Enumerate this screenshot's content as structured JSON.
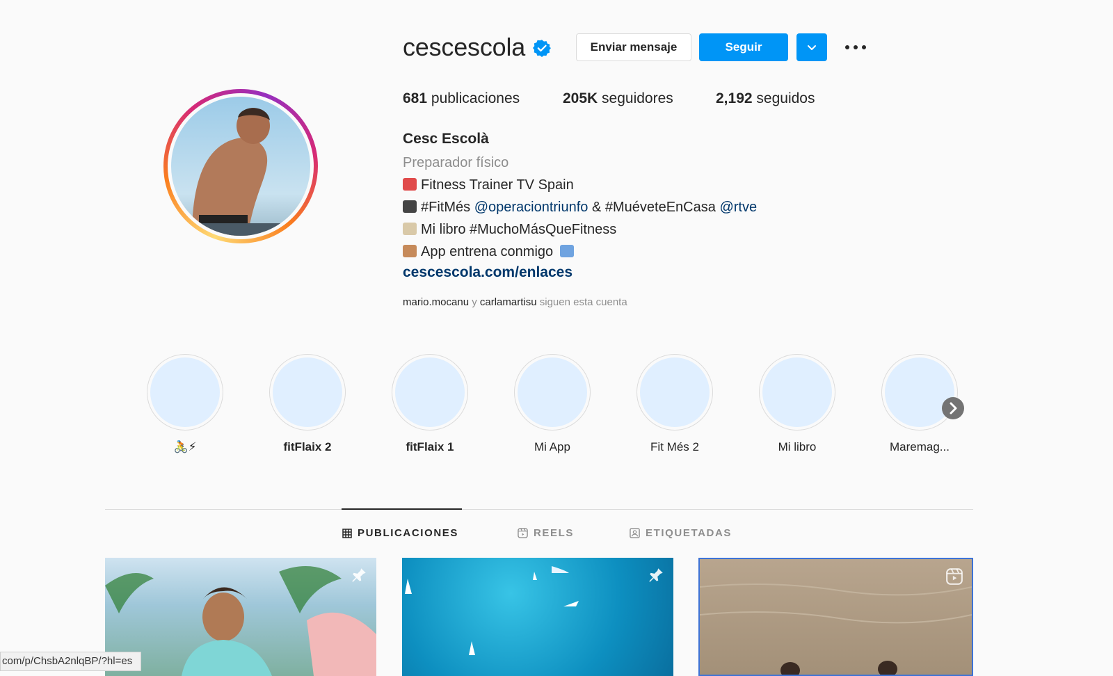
{
  "profile": {
    "username": "cescescola",
    "verified_icon": "verified-badge-icon",
    "buttons": {
      "message": "Enviar mensaje",
      "follow": "Seguir"
    },
    "stats": {
      "posts_count": "681",
      "posts_label": "publicaciones",
      "followers_count": "205K",
      "followers_label": "seguidores",
      "following_count": "2,192",
      "following_label": "seguidos"
    },
    "full_name": "Cesc Escolà",
    "category": "Preparador físico",
    "bio": {
      "line1": "Fitness Trainer TV Spain",
      "line2_a": "#FitMés",
      "line2_mention1": "@operaciontriunfo",
      "line2_b": "& #MuéveteEnCasa",
      "line2_mention2": "@rtve",
      "line3": "Mi libro #MuchoMásQueFitness",
      "line4": "App entrena conmigo"
    },
    "website": "cescescola.com/enlaces",
    "followed_by": {
      "user1": "mario.mocanu",
      "joiner": "y",
      "user2": "carlamartisu",
      "suffix": "siguen esta cuenta"
    }
  },
  "highlights": [
    {
      "label": "🚴⚡"
    },
    {
      "label": "fitFlaix 2"
    },
    {
      "label": "fitFlaix 1"
    },
    {
      "label": "Mi App"
    },
    {
      "label": "Fit Més 2"
    },
    {
      "label": "Mi libro"
    },
    {
      "label": "Maremag..."
    }
  ],
  "tabs": [
    {
      "label": "PUBLICACIONES",
      "active": true
    },
    {
      "label": "REELS",
      "active": false
    },
    {
      "label": "ETIQUETADAS",
      "active": false
    }
  ],
  "status_bar": {
    "url": "com/p/ChsbA2nlqBP/?hl=es"
  },
  "colors": {
    "accent": "#0095f6",
    "link": "#00376b",
    "muted": "#8e8e8e"
  }
}
